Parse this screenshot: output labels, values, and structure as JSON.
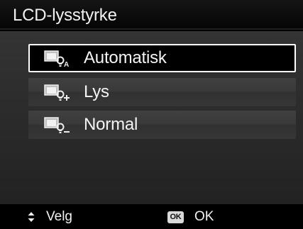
{
  "title_bar": {
    "title": "LCD-lysstyrke"
  },
  "menu": {
    "selected_index": 0,
    "items": [
      {
        "label": "Automatisk",
        "icon": "lcd-auto-brightness-icon",
        "selected": true
      },
      {
        "label": "Lys",
        "icon": "lcd-bright-brightness-icon",
        "selected": false
      },
      {
        "label": "Normal",
        "icon": "lcd-normal-brightness-icon",
        "selected": false
      }
    ]
  },
  "footer": {
    "select": {
      "icon": "up-down-arrows-icon",
      "label": "Velg"
    },
    "ok": {
      "icon": "ok-button-icon",
      "icon_text": "OK",
      "label": "OK"
    }
  },
  "colors": {
    "background": "#000000",
    "panel": "#2f2f2f",
    "item": "#393939",
    "selection_border": "#ffffff",
    "text": "#f4f4f4"
  }
}
